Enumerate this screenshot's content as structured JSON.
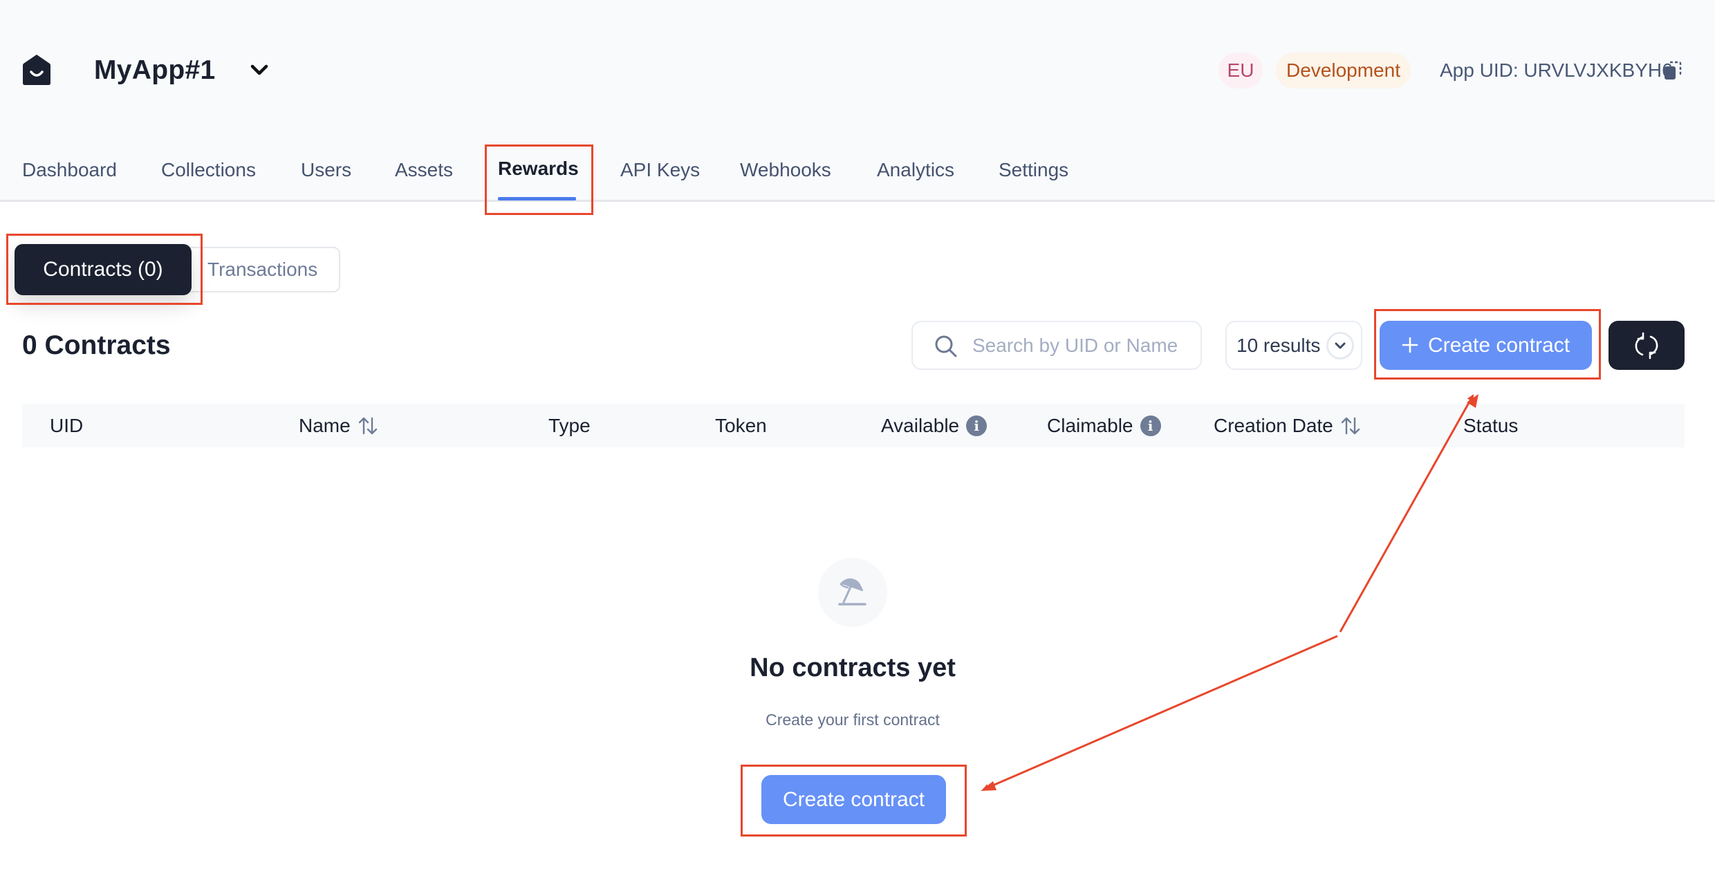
{
  "header": {
    "app_name": "MyApp#1",
    "region_badge": "EU",
    "environment_badge": "Development",
    "app_uid_label": "App UID: URVLVJXKBYH6"
  },
  "nav": {
    "tabs": [
      {
        "label": "Dashboard",
        "active": false
      },
      {
        "label": "Collections",
        "active": false
      },
      {
        "label": "Users",
        "active": false
      },
      {
        "label": "Assets",
        "active": false
      },
      {
        "label": "Rewards",
        "active": true
      },
      {
        "label": "API Keys",
        "active": false
      },
      {
        "label": "Webhooks",
        "active": false
      },
      {
        "label": "Analytics",
        "active": false
      },
      {
        "label": "Settings",
        "active": false
      }
    ]
  },
  "subtabs": {
    "contracts": "Contracts (0)",
    "transactions": "Transactions"
  },
  "toolbar": {
    "count_title": "0 Contracts",
    "search_placeholder": "Search by UID or Name",
    "search_value": "",
    "results_select": "10 results",
    "create_button": "Create contract",
    "create_icon": "plus-icon",
    "refresh_icon": "refresh-icon"
  },
  "table": {
    "columns": [
      {
        "label": "UID",
        "sortable": false,
        "info": false
      },
      {
        "label": "Name",
        "sortable": true,
        "info": false
      },
      {
        "label": "Type",
        "sortable": false,
        "info": false
      },
      {
        "label": "Token",
        "sortable": false,
        "info": false
      },
      {
        "label": "Available",
        "sortable": false,
        "info": true
      },
      {
        "label": "Claimable",
        "sortable": false,
        "info": true
      },
      {
        "label": "Creation Date",
        "sortable": true,
        "info": false
      },
      {
        "label": "Status",
        "sortable": false,
        "info": false
      }
    ],
    "rows": []
  },
  "empty_state": {
    "icon": "beach-umbrella-icon",
    "title": "No contracts yet",
    "subtitle": "Create your first contract",
    "button": "Create contract"
  },
  "info_glyph": "i",
  "colors": {
    "primary": "#6691f6",
    "dark": "#1b2130",
    "active_tab_underline": "#4b7bec",
    "annotation": "#e8472d",
    "eu_badge_bg": "#fdf0f5",
    "eu_badge_text": "#b8466d",
    "dev_badge_bg": "#fdf4ea",
    "dev_badge_text": "#b4521c"
  }
}
